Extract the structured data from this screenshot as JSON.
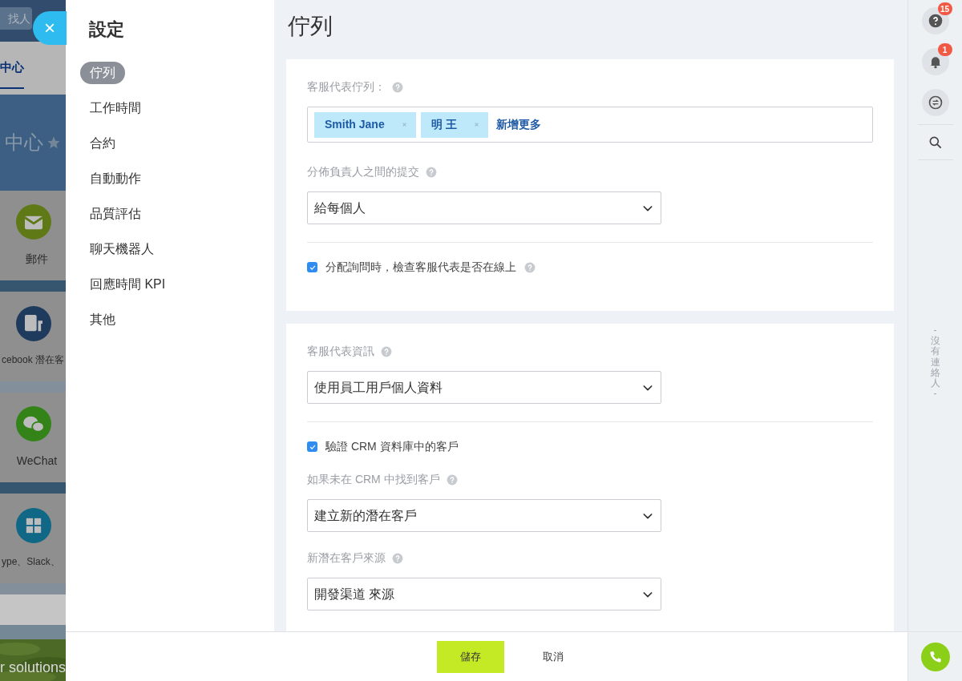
{
  "background_page": {
    "search_placeholder": "找人",
    "tab": "中心",
    "header": "中心",
    "apps": [
      {
        "kind": "mail",
        "label": "郵件"
      },
      {
        "kind": "facebook",
        "label": "cebook 潛在客"
      },
      {
        "kind": "wechat",
        "label": "WeChat"
      },
      {
        "kind": "grid",
        "label": "ype、Slack、"
      }
    ],
    "footer_text": "r solutions"
  },
  "close_button": "×",
  "settings_nav": {
    "title": "設定",
    "items": [
      {
        "label": "佇列",
        "selected": true
      },
      {
        "label": "工作時間",
        "selected": false
      },
      {
        "label": "合約",
        "selected": false
      },
      {
        "label": "自動動作",
        "selected": false
      },
      {
        "label": "品質評估",
        "selected": false
      },
      {
        "label": "聊天機器人",
        "selected": false
      },
      {
        "label": "回應時間 KPI",
        "selected": false
      },
      {
        "label": "其他",
        "selected": false
      }
    ]
  },
  "page_title": "佇列",
  "cards": [
    {
      "fields": [
        {
          "kind": "tags",
          "label": "客服代表佇列：",
          "help": true,
          "tags": [
            "Smith Jane",
            "明 王"
          ],
          "add_link": "新增更多"
        },
        {
          "kind": "select",
          "label": "分佈負責人之間的提交",
          "help": true,
          "value": "給每個人"
        },
        {
          "kind": "divider"
        },
        {
          "kind": "checkbox",
          "label": "分配詢問時，檢查客服代表是否在線上",
          "checked": true,
          "help": true
        }
      ]
    },
    {
      "fields": [
        {
          "kind": "select",
          "label": "客服代表資訊",
          "help": true,
          "value": "使用員工用戶個人資料"
        },
        {
          "kind": "divider"
        },
        {
          "kind": "checkbox",
          "label": "驗證 CRM 資料庫中的客戶",
          "checked": true,
          "help": false
        },
        {
          "kind": "select",
          "label": "如果未在 CRM 中找到客戶",
          "help": true,
          "value": "建立新的潛在客戶"
        },
        {
          "kind": "select",
          "label": "新潛在客戶來源",
          "help": true,
          "value": "開發渠道 來源"
        }
      ]
    }
  ],
  "footer": {
    "save": "儲存",
    "cancel": "取消"
  },
  "right_bar": {
    "help_badge": "15",
    "notifications_badge": "1",
    "empty_text": "- 沒有連絡人 -"
  }
}
